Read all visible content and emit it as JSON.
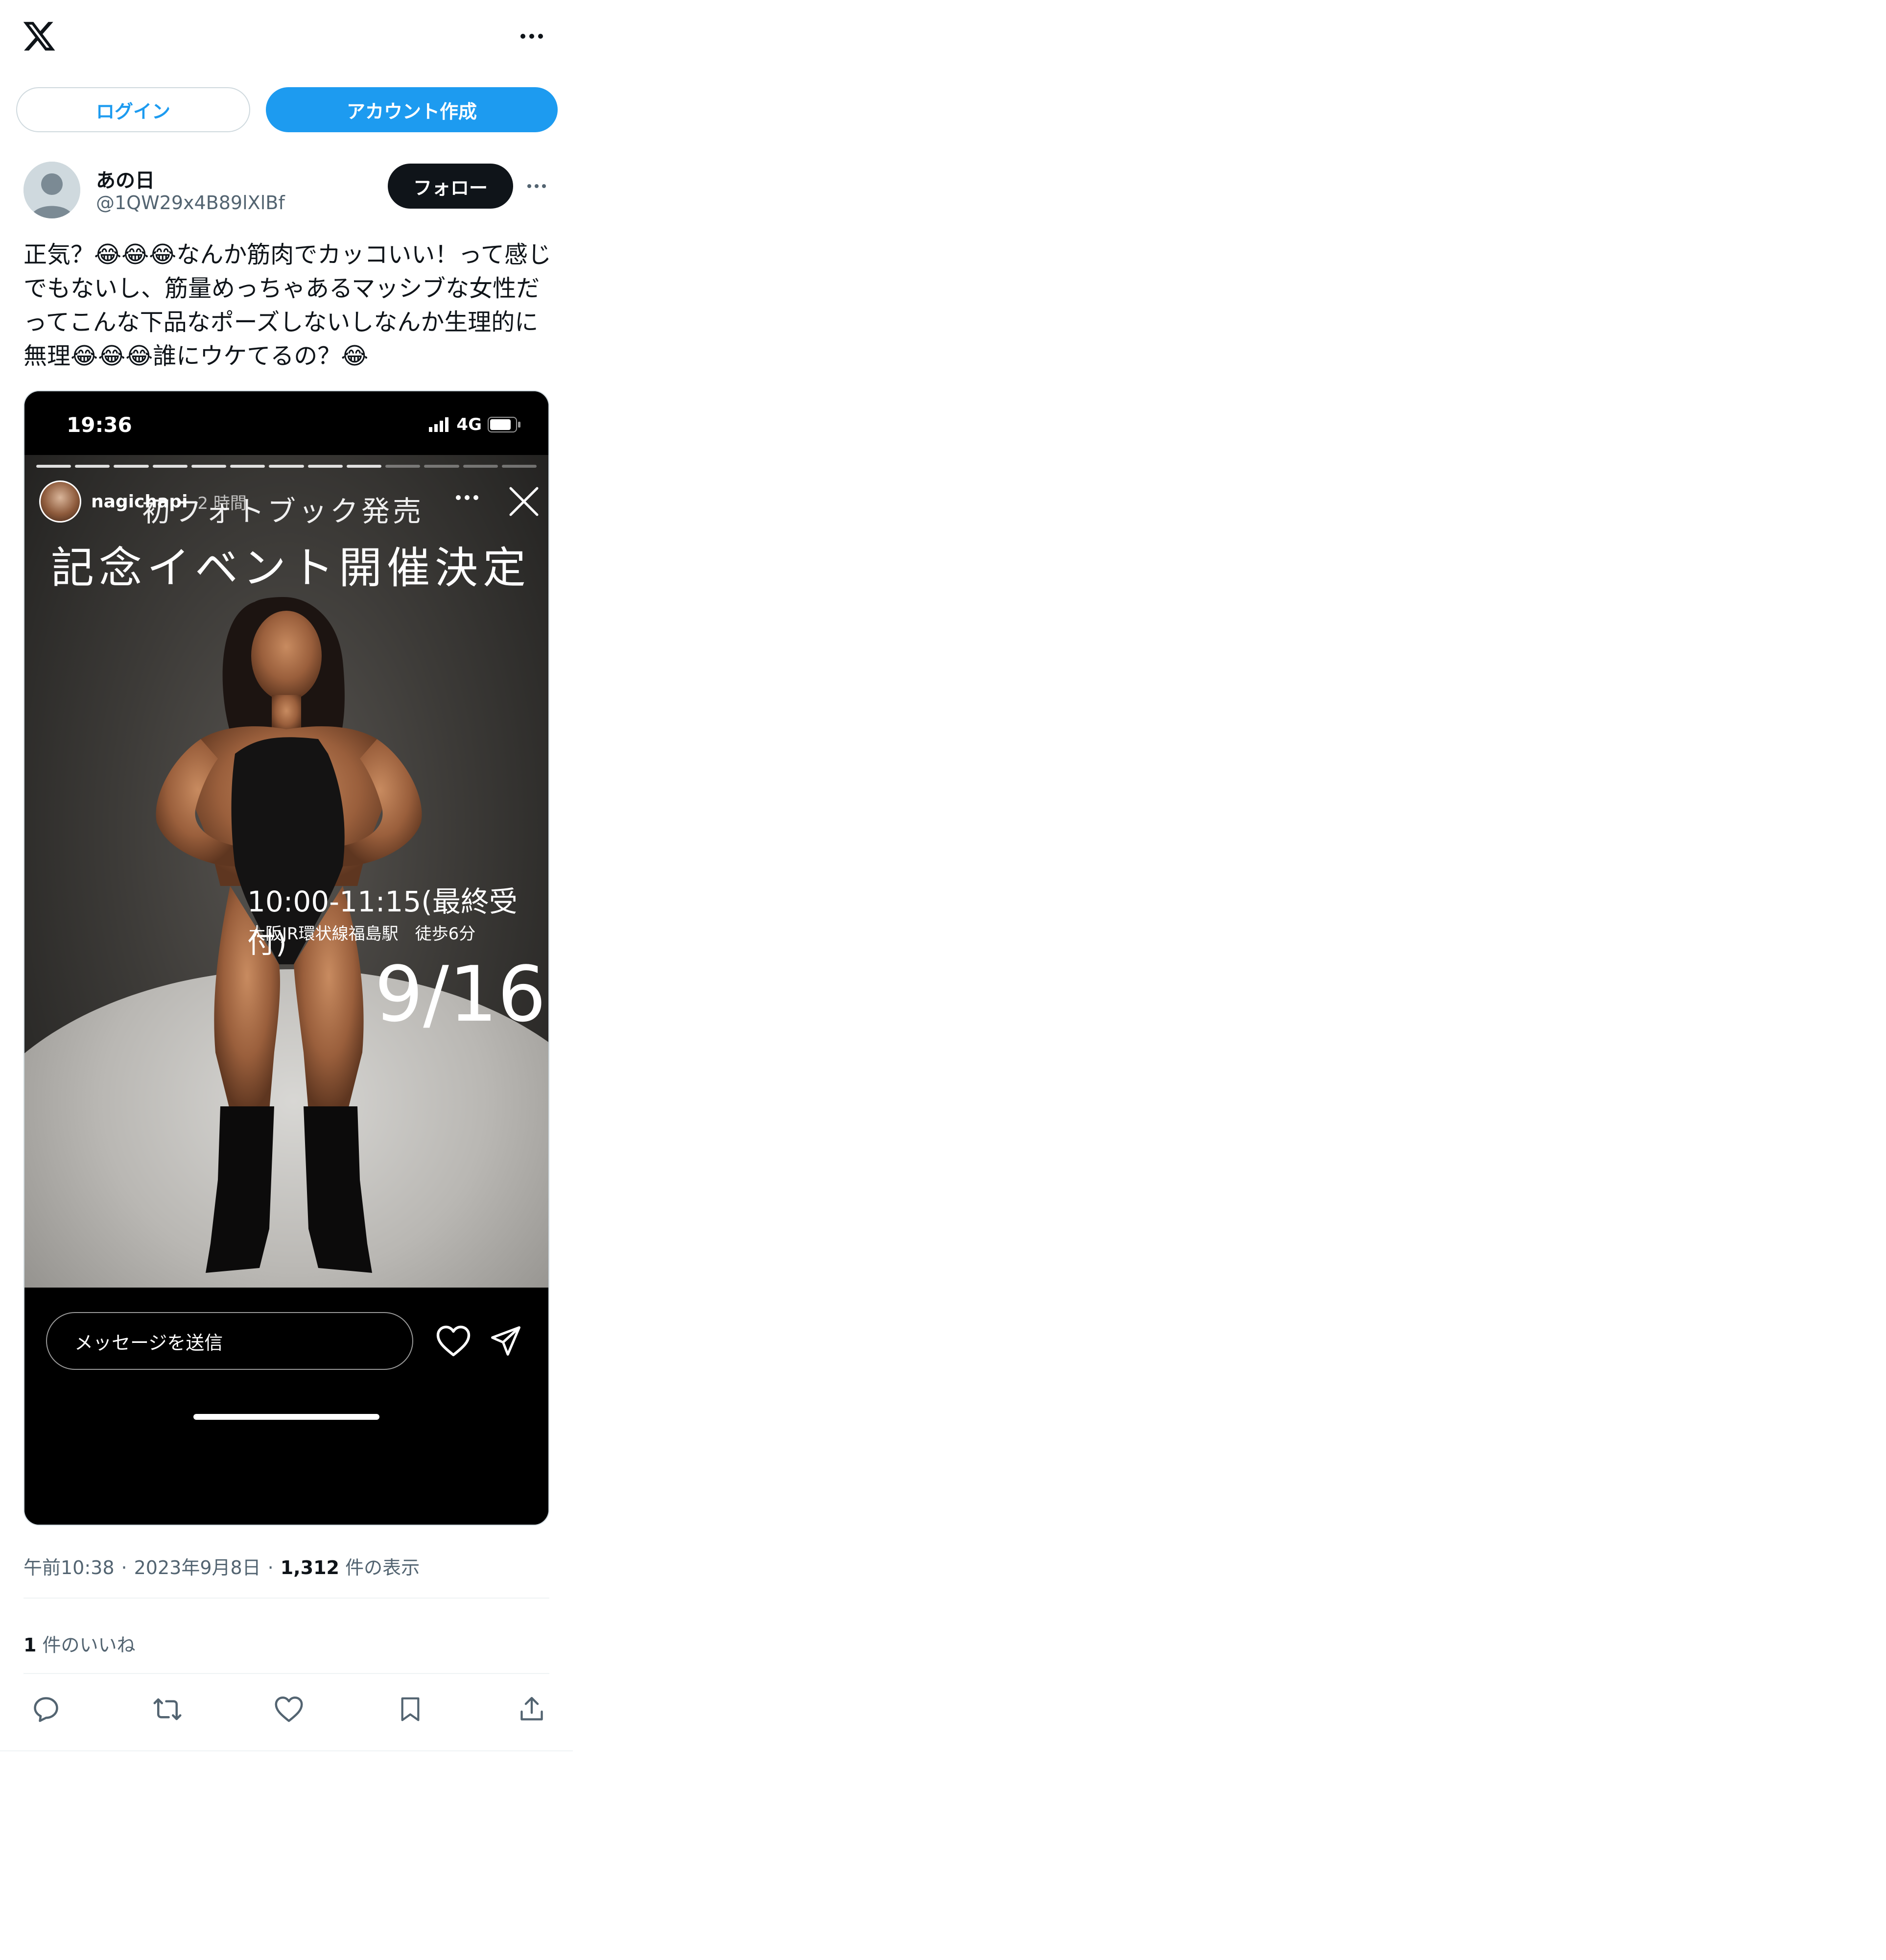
{
  "topbar": {
    "logo_icon": "x-logo-icon",
    "more_icon": "more-horizontal-icon"
  },
  "auth": {
    "login_label": "ログイン",
    "signup_label": "アカウント作成"
  },
  "author": {
    "display_name": "あの日",
    "handle": "@1QW29x4B89lXlBf",
    "follow_label": "フォロー"
  },
  "tweet": {
    "text": "正気？😂😂😂なんか筋肉でカッコいい！って感じでもないし、筋量めっちゃあるマッシブな女性だってこんな下品なポーズしないしなんか生理的に無理😂😂😂誰にウケてるの？😂"
  },
  "media": {
    "status_time": "19:36",
    "status_network": "4G",
    "story_username": "nagichapi",
    "story_time": "2 時間",
    "title_line1": "初フォトブック発売",
    "title_line2": "記念イベント開催決定",
    "hours": "10:00-11:15(最終受付)",
    "place": "大阪JR環状線福島駅　徒歩6分",
    "date": "9/16",
    "message_placeholder": "メッセージを送信"
  },
  "meta": {
    "time": "午前10:38",
    "date": "2023年9月8日",
    "views_count": "1,312",
    "views_label": "件の表示",
    "separator": "·"
  },
  "likes": {
    "count": "1",
    "label": "件のいいね"
  },
  "colors": {
    "accent": "#1d9bf0",
    "text": "#0f1419",
    "secondary": "#536471",
    "border": "#cfd9de"
  }
}
